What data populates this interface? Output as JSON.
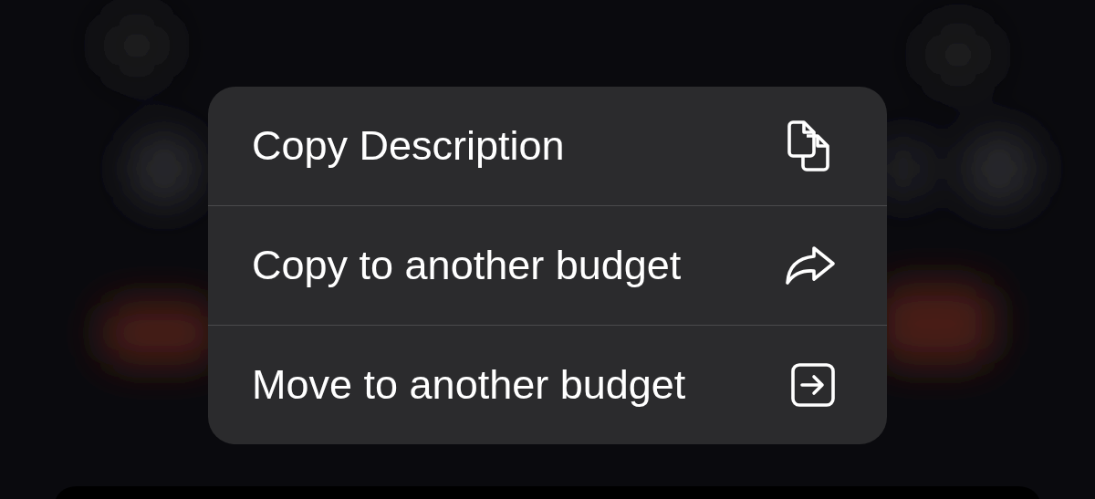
{
  "context_menu": {
    "items": [
      {
        "label": "Copy Description",
        "kind": "copy"
      },
      {
        "label": "Copy to another budget",
        "kind": "share"
      },
      {
        "label": "Move to another budget",
        "kind": "move"
      }
    ]
  }
}
